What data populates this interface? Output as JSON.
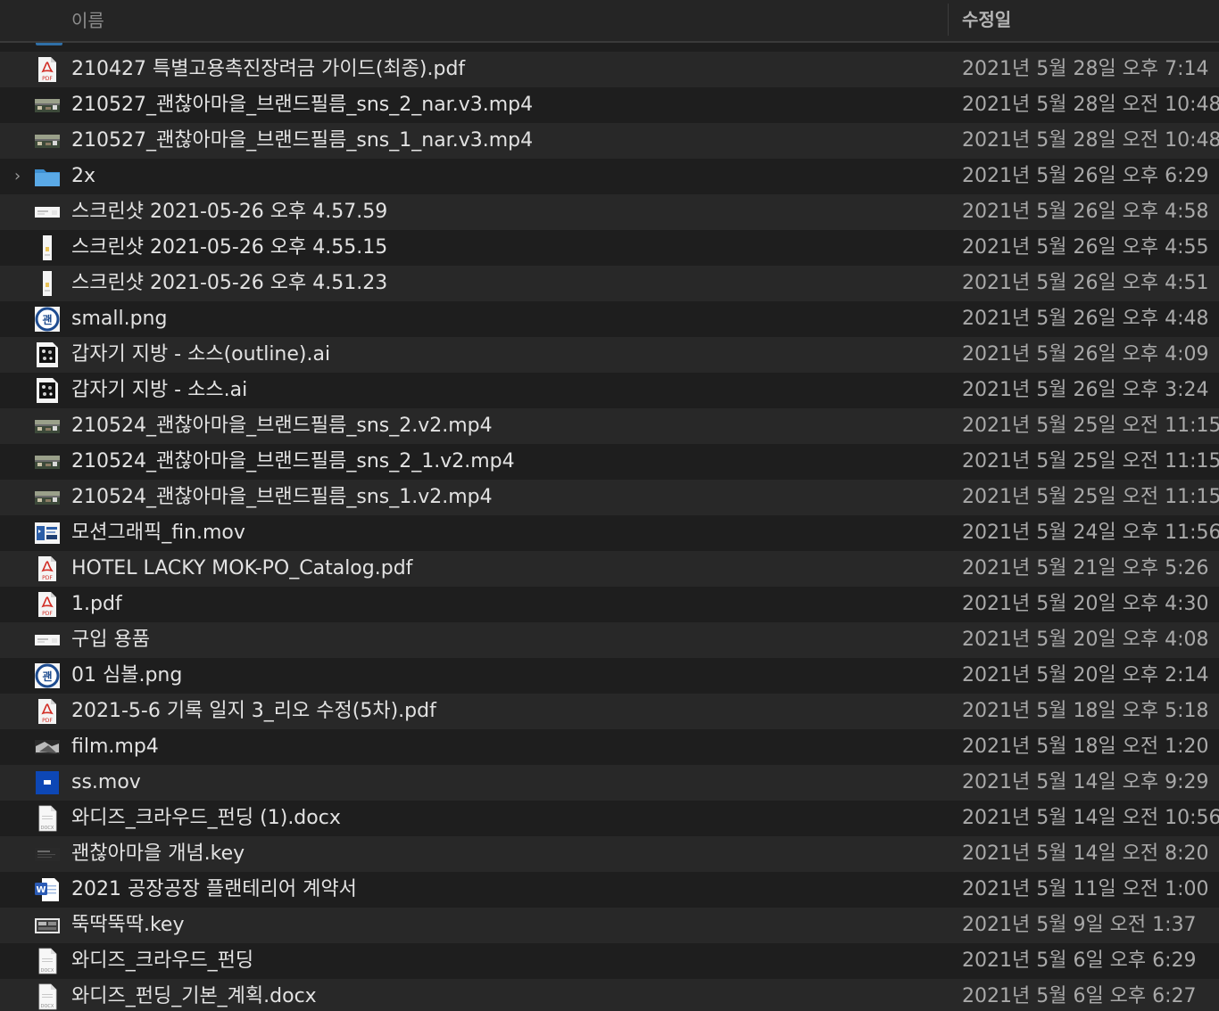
{
  "header": {
    "name_label": "이름",
    "date_label": "수정일"
  },
  "files": [
    {
      "name": "210427 특별고용촉진장려금 가이드(최종).pdf",
      "modified": "2021년 5월 28일 오후 7:14",
      "icon": "pdf-icon"
    },
    {
      "name": "210527_괜찮아마을_브랜드필름_sns_2_nar.v3.mp4",
      "modified": "2021년 5월 28일 오전 10:48",
      "icon": "video-thumbnail-icon"
    },
    {
      "name": "210527_괜찮아마을_브랜드필름_sns_1_nar.v3.mp4",
      "modified": "2021년 5월 28일 오전 10:48",
      "icon": "video-thumbnail-icon"
    },
    {
      "name": "2x",
      "modified": "2021년 5월 26일 오후 6:29",
      "icon": "folder-icon"
    },
    {
      "name": "스크린샷 2021-05-26 오후 4.57.59",
      "modified": "2021년 5월 26일 오후 4:58",
      "icon": "screenshot-wide-icon"
    },
    {
      "name": "스크린샷 2021-05-26 오후 4.55.15",
      "modified": "2021년 5월 26일 오후 4:55",
      "icon": "screenshot-tall-icon"
    },
    {
      "name": "스크린샷 2021-05-26 오후 4.51.23",
      "modified": "2021년 5월 26일 오후 4:51",
      "icon": "screenshot-tall-icon"
    },
    {
      "name": "small.png",
      "modified": "2021년 5월 26일 오후 4:48",
      "icon": "round-logo-icon"
    },
    {
      "name": "갑자기 지방 - 소스(outline).ai",
      "modified": "2021년 5월 26일 오후 4:09",
      "icon": "illustrator-icon"
    },
    {
      "name": "갑자기 지방 - 소스.ai",
      "modified": "2021년 5월 26일 오후 3:24",
      "icon": "illustrator-icon"
    },
    {
      "name": "210524_괜찮아마을_브랜드필름_sns_2.v2.mp4",
      "modified": "2021년 5월 25일 오전 11:15",
      "icon": "video-thumbnail-icon"
    },
    {
      "name": "210524_괜찮아마을_브랜드필름_sns_2_1.v2.mp4",
      "modified": "2021년 5월 25일 오전 11:15",
      "icon": "video-thumbnail-icon"
    },
    {
      "name": "210524_괜찮아마을_브랜드필름_sns_1.v2.mp4",
      "modified": "2021년 5월 25일 오전 11:15",
      "icon": "video-thumbnail-icon"
    },
    {
      "name": "모션그래픽_fin.mov",
      "modified": "2021년 5월 24일 오후 11:56",
      "icon": "motion-graphic-icon"
    },
    {
      "name": "HOTEL LACKY MOK-PO_Catalog.pdf",
      "modified": "2021년 5월 21일 오후 5:26",
      "icon": "pdf-icon"
    },
    {
      "name": "1.pdf",
      "modified": "2021년 5월 20일 오후 4:30",
      "icon": "pdf-icon"
    },
    {
      "name": "구입 용품",
      "modified": "2021년 5월 20일 오후 4:08",
      "icon": "screenshot-wide-icon"
    },
    {
      "name": "01 심볼.png",
      "modified": "2021년 5월 20일 오후 2:14",
      "icon": "round-logo-icon"
    },
    {
      "name": "2021-5-6 기록 일지 3_리오 수정(5차).pdf",
      "modified": "2021년 5월 18일 오후 5:18",
      "icon": "pdf-icon"
    },
    {
      "name": "film.mp4",
      "modified": "2021년 5월 18일 오전 1:20",
      "icon": "film-icon"
    },
    {
      "name": "ss.mov",
      "modified": "2021년 5월 14일 오후 9:29",
      "icon": "blue-video-icon"
    },
    {
      "name": "와디즈_크라우드_펀딩 (1).docx",
      "modified": "2021년 5월 14일 오전 10:56",
      "icon": "docx-icon"
    },
    {
      "name": "괜찮아마을 개념.key",
      "modified": "2021년 5월 14일 오전 8:20",
      "icon": "keynote-dark-icon"
    },
    {
      "name": "2021 공장공장 플랜테리어 계약서",
      "modified": "2021년 5월 11일 오전 1:00",
      "icon": "word-icon"
    },
    {
      "name": "뚝딱뚝딱.key",
      "modified": "2021년 5월 9일 오전 1:37",
      "icon": "keynote-icon"
    },
    {
      "name": "와디즈_크라우드_펀딩",
      "modified": "2021년 5월 6일 오후 6:29",
      "icon": "docx-icon"
    },
    {
      "name": "와디즈_펀딩_기본_계획.docx",
      "modified": "2021년 5월 6일 오후 6:27",
      "icon": "docx-icon"
    }
  ]
}
